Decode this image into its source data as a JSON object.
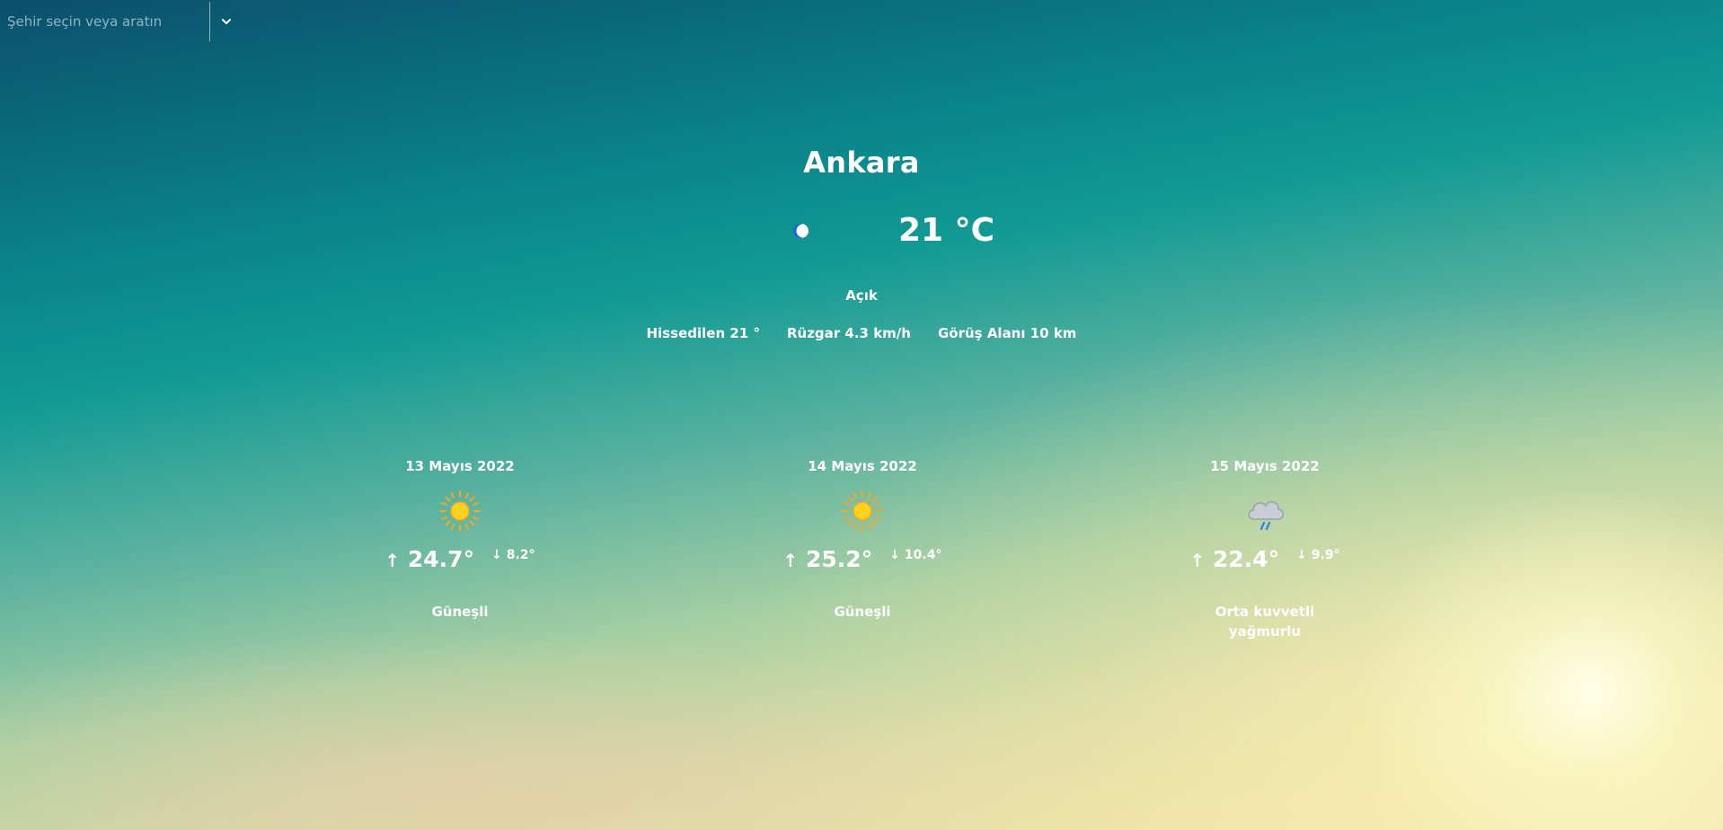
{
  "search": {
    "placeholder": "Şehir seçin veya aratın",
    "dropdown_icon": "chevron-down-icon"
  },
  "current": {
    "city": "Ankara",
    "icon": "moon-icon",
    "temperature": "21 °C",
    "condition": "Açık",
    "feels_like": "Hissedilen 21 °",
    "wind": "Rüzgar 4.3 km/h",
    "visibility": "Görüş Alanı 10 km"
  },
  "forecast": [
    {
      "date": "13 Mayıs 2022",
      "icon": "sun-icon",
      "max": "24.7°",
      "min": "8.2°",
      "description": "Güneşli"
    },
    {
      "date": "14 Mayıs 2022",
      "icon": "sun-icon",
      "max": "25.2°",
      "min": "10.4°",
      "description": "Güneşli"
    },
    {
      "date": "15 Mayıs 2022",
      "icon": "rain-cloud-icon",
      "max": "22.4°",
      "min": "9.9°",
      "description": "Orta kuvvetli yağmurlu"
    }
  ],
  "arrows": {
    "up": "↑",
    "down": "↓"
  },
  "colors": {
    "sun": "#ffd21f",
    "sun_ray": "#f5a623",
    "moon": "#1e63d6",
    "cloud": "#c9ced6",
    "rain": "#2f7de0"
  }
}
